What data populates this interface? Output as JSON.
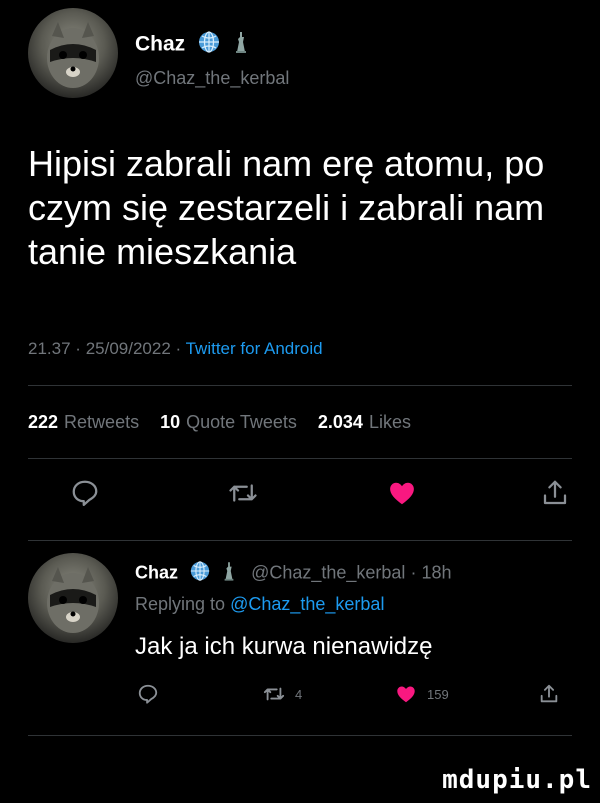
{
  "tweet": {
    "author_name": "Chaz",
    "author_handle": "@Chaz_the_kerbal",
    "text": "Hipisi zabrali nam erę atomu, po czym się zestarzeli i zabrali nam tanie mieszkania",
    "time": "21.37",
    "date": "25/09/2022",
    "source": "Twitter for Android",
    "separator": "·",
    "stats": {
      "retweets_count": "222",
      "retweets_label": "Retweets",
      "quotes_count": "10",
      "quotes_label": "Quote Tweets",
      "likes_count": "2.034",
      "likes_label": "Likes"
    }
  },
  "reply": {
    "author_name": "Chaz",
    "author_handle": "@Chaz_the_kerbal",
    "age": "18h",
    "replying_prefix": "Replying to",
    "replying_to": "@Chaz_the_kerbal",
    "text": "Jak ja ich kurwa nienawidzę",
    "retweet_count": "4",
    "like_count": "159"
  },
  "icons": {
    "reply": "reply-icon",
    "retweet": "retweet-icon",
    "like": "heart-icon",
    "share": "share-icon",
    "badge_globe": "globe-icon",
    "badge_statue": "statue-of-liberty-icon"
  },
  "colors": {
    "background": "#000000",
    "text": "#ffffff",
    "muted": "#71767b",
    "link": "#1d9bf0",
    "like": "#f91880",
    "globe_badge": "#4a9bd8"
  },
  "watermark": "mdupiu.pl"
}
